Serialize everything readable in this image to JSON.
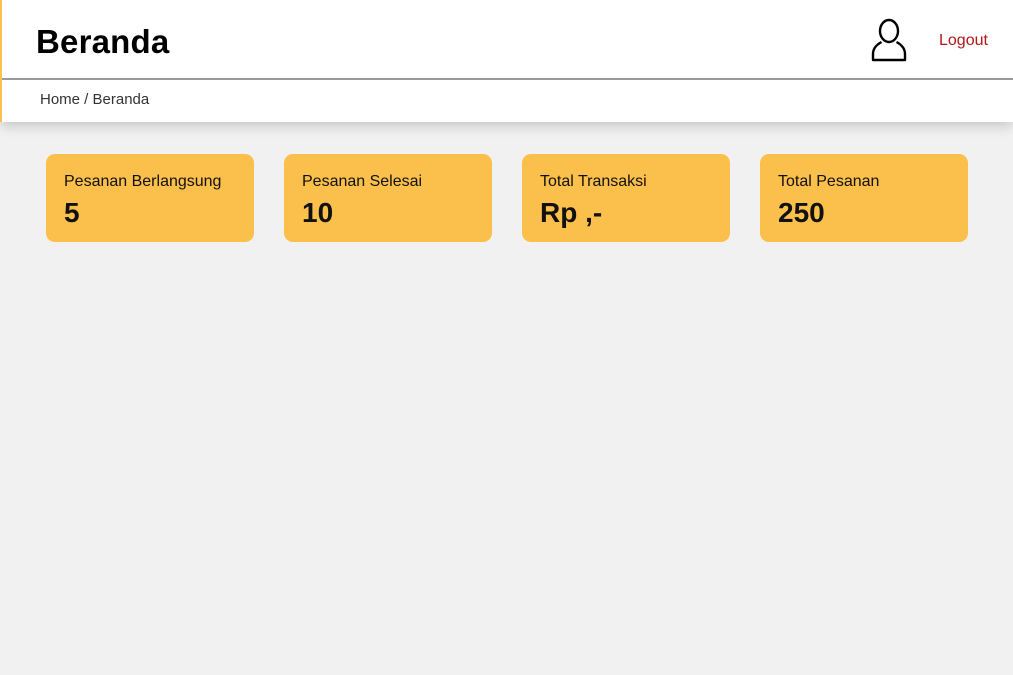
{
  "header": {
    "title": "Beranda",
    "user_icon": "user-icon",
    "logout_label": "Logout"
  },
  "breadcrumb": {
    "text": "Home / Beranda"
  },
  "cards": [
    {
      "label": "Pesanan Berlangsung",
      "value": "5"
    },
    {
      "label": "Pesanan Selesai",
      "value": "10"
    },
    {
      "label": "Total Transaksi",
      "value": "Rp ,-"
    },
    {
      "label": "Total Pesanan",
      "value": "250"
    }
  ],
  "colors": {
    "accent": "#fbbf4b",
    "logout": "#b01717",
    "background": "#f1f1f1"
  }
}
